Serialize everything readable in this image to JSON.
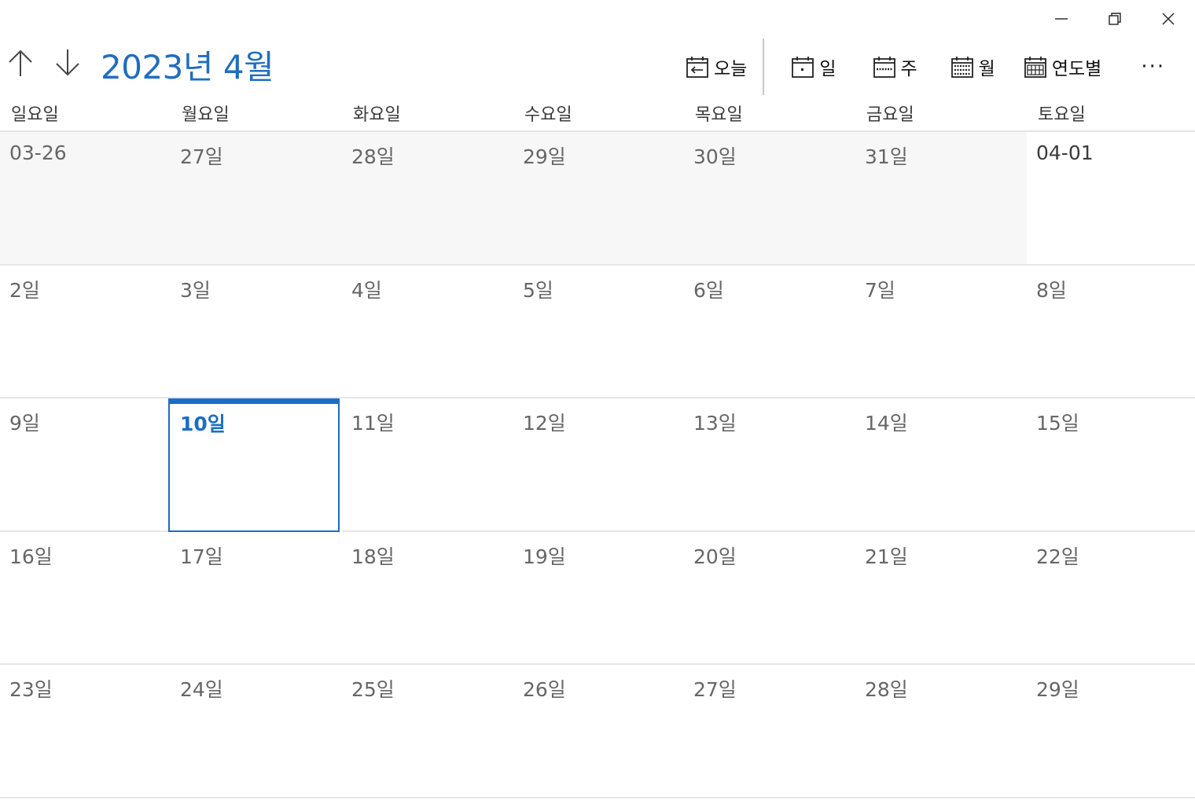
{
  "window": {
    "controls": {
      "minimize_icon": "minimize-icon",
      "restore_icon": "restore-icon",
      "close_icon": "close-icon"
    }
  },
  "header": {
    "title": "2023년 4월",
    "prev_icon": "arrow-up-icon",
    "next_icon": "arrow-down-icon"
  },
  "toolbar": {
    "today_label": "오늘",
    "day_label": "일",
    "week_label": "주",
    "month_label": "월",
    "year_label": "연도별",
    "more_label": "···"
  },
  "colors": {
    "accent": "#1a6ec5",
    "title": "#1f6ec0",
    "other_month_bg": "#f7f7f7"
  },
  "weekdays": [
    "일요일",
    "월요일",
    "화요일",
    "수요일",
    "목요일",
    "금요일",
    "토요일"
  ],
  "weeks": [
    [
      "03-26",
      "27일",
      "28일",
      "29일",
      "30일",
      "31일",
      "04-01"
    ],
    [
      "2일",
      "3일",
      "4일",
      "5일",
      "6일",
      "7일",
      "8일"
    ],
    [
      "9일",
      "10일",
      "11일",
      "12일",
      "13일",
      "14일",
      "15일"
    ],
    [
      "16일",
      "17일",
      "18일",
      "19일",
      "20일",
      "21일",
      "22일"
    ],
    [
      "23일",
      "24일",
      "25일",
      "26일",
      "27일",
      "28일",
      "29일"
    ]
  ],
  "today": "10일"
}
